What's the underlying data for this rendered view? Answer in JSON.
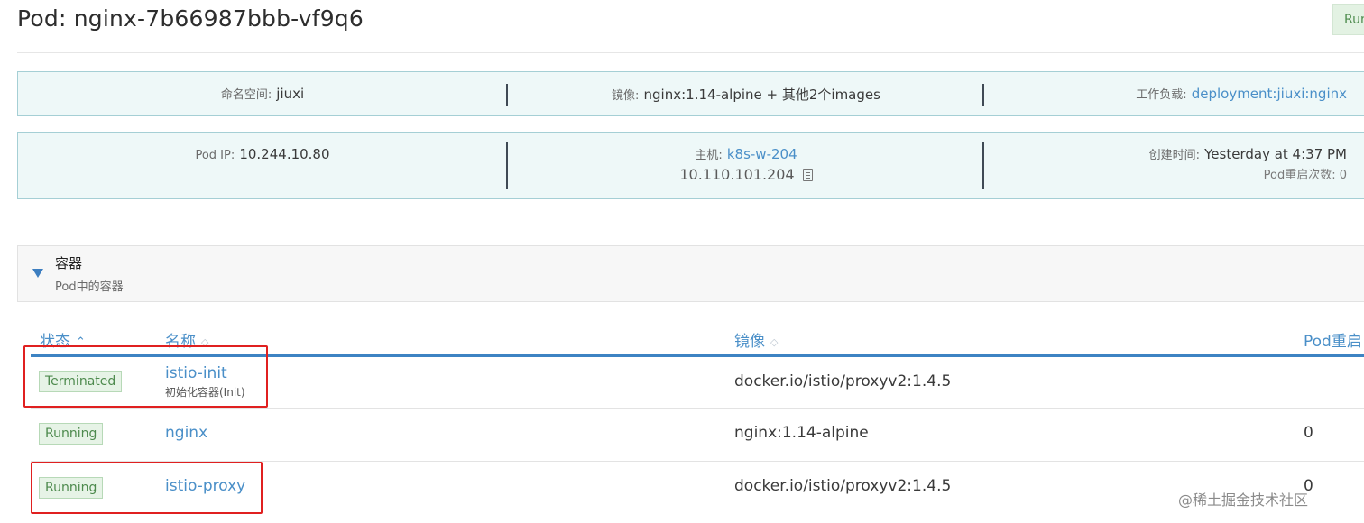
{
  "page": {
    "title": "Pod: nginx-7b66987bbb-vf9q6",
    "state_chip": "Run"
  },
  "info_row1": {
    "namespace_label": "命名空间:",
    "namespace_value": "jiuxi",
    "image_label": "镜像:",
    "image_value": "nginx:1.14-alpine + 其他2个images",
    "workload_label": "工作负载:",
    "workload_value": "deployment:jiuxi:nginx"
  },
  "info_row2": {
    "pod_ip_label": "Pod IP:",
    "pod_ip_value": "10.244.10.80",
    "host_label": "主机:",
    "host_value": "k8s-w-204",
    "host_ip": "10.110.101.204",
    "created_label": "创建时间:",
    "created_value": "Yesterday at 4:37 PM",
    "restarts_label": "Pod重启次数:",
    "restarts_value": "0"
  },
  "section": {
    "title": "容器",
    "subtitle": "Pod中的容器"
  },
  "table": {
    "headers": {
      "state": "状态",
      "name": "名称",
      "image": "镜像",
      "restarts": "Pod重启"
    },
    "rows": [
      {
        "state": "Terminated",
        "name": "istio-init",
        "subtitle": "初始化容器(Init)",
        "image": "docker.io/istio/proxyv2:1.4.5",
        "restarts": ""
      },
      {
        "state": "Running",
        "name": "nginx",
        "subtitle": "",
        "image": "nginx:1.14-alpine",
        "restarts": "0"
      },
      {
        "state": "Running",
        "name": "istio-proxy",
        "subtitle": "",
        "image": "docker.io/istio/proxyv2:1.4.5",
        "restarts": "0"
      }
    ]
  },
  "watermark": "@稀土掘金技术社区",
  "icons": {
    "copy": "copy-icon",
    "collapse": "caret-down-icon",
    "sort_active": "sort-asc-icon",
    "sort": "sort-icon"
  },
  "colors": {
    "accent": "#4a8fc8",
    "info_bg": "#eef8f8",
    "badge_green": "#e6f3e6",
    "highlight": "#e02020"
  }
}
